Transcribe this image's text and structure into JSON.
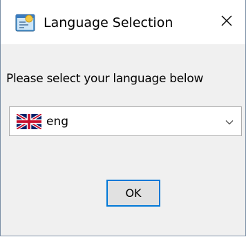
{
  "window": {
    "title": "Language Selection",
    "close_icon": "close-icon",
    "app_icon": "application-icon"
  },
  "dialog": {
    "prompt": "Please select your language below",
    "language_select": {
      "selected_value": "eng",
      "flag_icon": "uk-flag-icon",
      "arrow_icon": "chevron-down-icon"
    },
    "ok_label": "OK"
  },
  "colors": {
    "accent": "#0078d7",
    "content_bg": "#f0f0f0",
    "button_bg": "#e1e1e1"
  }
}
